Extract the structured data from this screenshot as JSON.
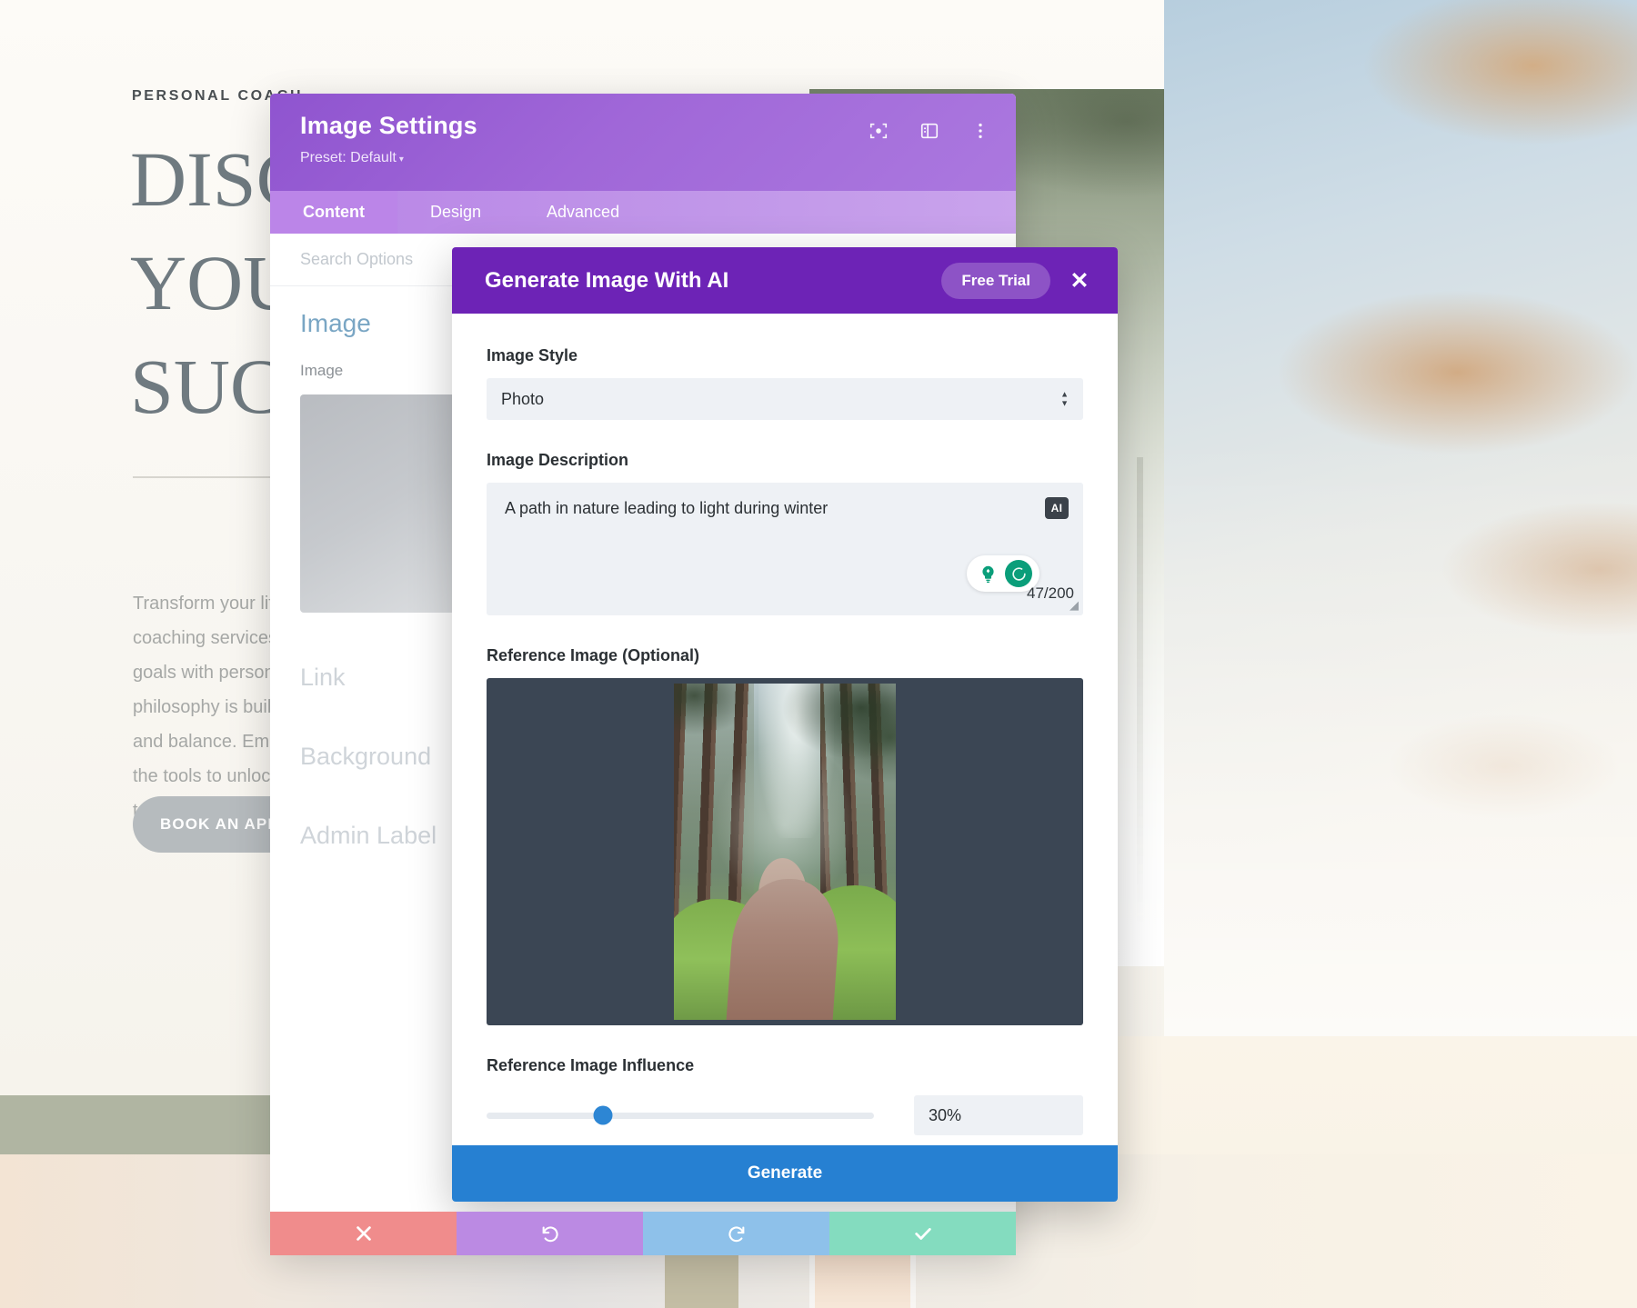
{
  "page": {
    "eyebrow": "PERSONAL COACH",
    "title": "DISCOVER\nYOUR\nSUCCESS",
    "paragraph": "Transform your life with our expert coaching services. Achieve your goals with personalized plans. Our philosophy is built on growth, clarity and balance. Empower yourself with the tools to unlock your full potential today.",
    "cta_label": "BOOK AN APPOINTMENT"
  },
  "divi": {
    "title": "Image Settings",
    "preset_label": "Preset: Default",
    "preset_caret": "▾",
    "icons": {
      "focus": "focus-target-icon",
      "layout": "layout-panel-icon",
      "more": "more-vertical-icon"
    },
    "tabs": [
      {
        "label": "Content",
        "active": true
      },
      {
        "label": "Design",
        "active": false
      },
      {
        "label": "Advanced",
        "active": false
      }
    ],
    "search_placeholder": "Search Options",
    "section_title": "Image",
    "image_field_label": "Image",
    "toggles": [
      "Link",
      "Background",
      "Admin Label"
    ]
  },
  "ai_modal": {
    "title": "Generate Image With AI",
    "free_trial_label": "Free Trial",
    "close_label": "✕",
    "image_style": {
      "label": "Image Style",
      "value": "Photo"
    },
    "image_description": {
      "label": "Image Description",
      "value": "A path in nature leading to light during winter",
      "badge": "AI",
      "char_count": "47/200",
      "buttons": [
        "idea-lightbulb-icon",
        "regenerate-spinner-icon"
      ]
    },
    "reference_image": {
      "label": "Reference Image (Optional)",
      "alt": "forest-path-thumbnail"
    },
    "reference_influence": {
      "label": "Reference Image Influence",
      "value": "30%",
      "percent": 30
    },
    "generate_label": "Generate"
  },
  "action_bar": [
    {
      "name": "cancel-button",
      "icon": "close-icon",
      "color": "#f08c8c"
    },
    {
      "name": "undo-button",
      "icon": "undo-icon",
      "color": "#bb8ae3"
    },
    {
      "name": "redo-button",
      "icon": "redo-icon",
      "color": "#8ec1ea"
    },
    {
      "name": "save-button",
      "icon": "check-icon",
      "color": "#84dcbf"
    }
  ],
  "colors": {
    "ai_header": "#6d23b6",
    "divi_header": "#a067d8",
    "generate": "#2680d2",
    "slider": "#2d86d4",
    "accent_green": "#0a9e7a"
  }
}
